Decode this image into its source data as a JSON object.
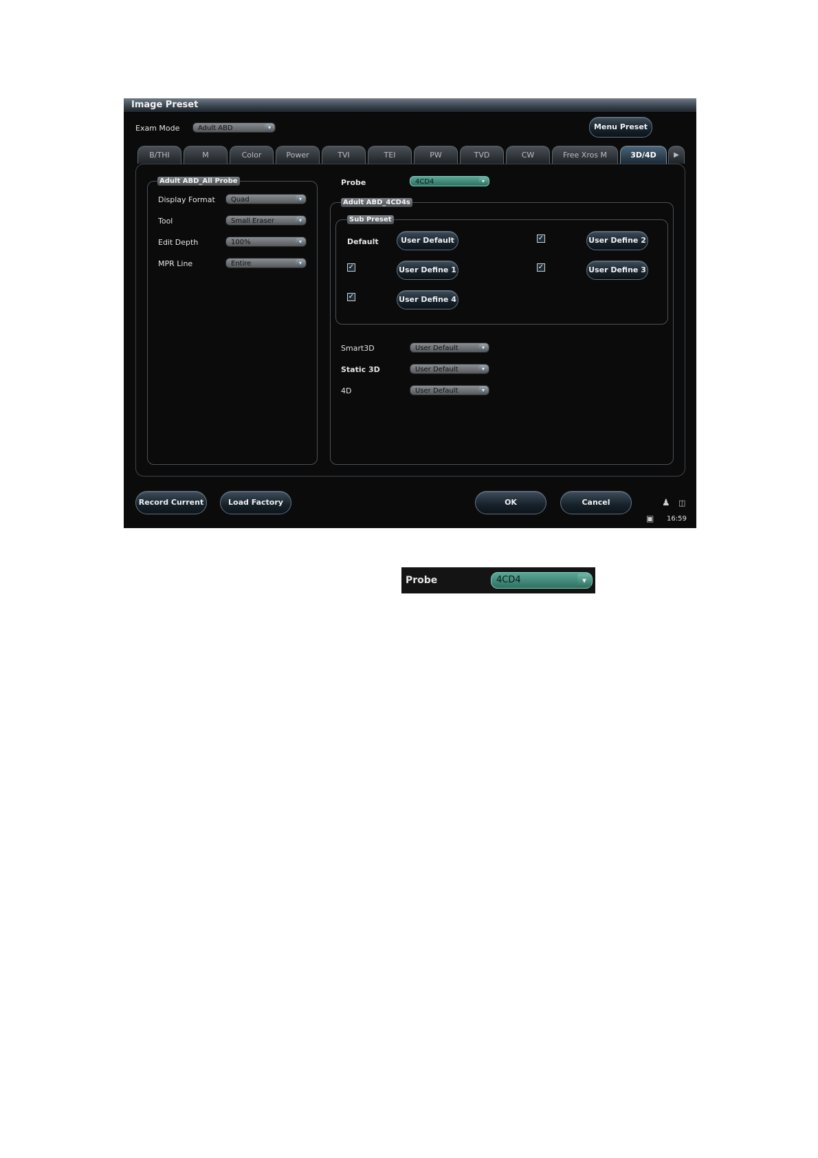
{
  "window": {
    "title": "Image Preset"
  },
  "exam_mode": {
    "label": "Exam Mode",
    "value": "Adult ABD"
  },
  "menu_preset_label": "Menu Preset",
  "tabs": [
    {
      "label": "B/THI"
    },
    {
      "label": "M"
    },
    {
      "label": "Color"
    },
    {
      "label": "Power"
    },
    {
      "label": "TVI"
    },
    {
      "label": "TEI"
    },
    {
      "label": "PW"
    },
    {
      "label": "TVD"
    },
    {
      "label": "CW"
    },
    {
      "label": "Free Xros M"
    },
    {
      "label": "3D/4D",
      "active": true
    }
  ],
  "left_panel": {
    "legend": "Adult ABD_All Probe",
    "rows": [
      {
        "label": "Display Format",
        "value": "Quad"
      },
      {
        "label": "Tool",
        "value": "Small Eraser"
      },
      {
        "label": "Edit Depth",
        "value": "100%"
      },
      {
        "label": "MPR Line",
        "value": "Entire"
      }
    ]
  },
  "probe": {
    "label": "Probe",
    "value": "4CD4"
  },
  "right_panel": {
    "legend": "Adult ABD_4CD4s",
    "sub_preset": {
      "legend": "Sub Preset",
      "default_label": "Default",
      "user_default_label": "User Default",
      "user_define_1": "User Define 1",
      "user_define_2": "User Define 2",
      "user_define_3": "User Define 3",
      "user_define_4": "User Define 4",
      "check_glyph": "✓"
    },
    "modes": [
      {
        "label": "Smart3D",
        "value": "User Default"
      },
      {
        "label": "Static 3D",
        "value": "User Default"
      },
      {
        "label": "4D",
        "value": "User Default"
      }
    ]
  },
  "footer": {
    "record_current": "Record Current",
    "load_factory": "Load Factory",
    "ok": "OK",
    "cancel": "Cancel",
    "time": "16:59"
  },
  "zoom_inset": {
    "label": "Probe",
    "value": "4CD4"
  },
  "icons": {
    "dropdown_arrow": "▾",
    "scroll_right": "▶",
    "user": "user-icon",
    "trash": "trash-icon",
    "monitor": "monitor-icon"
  },
  "colors": {
    "background": "#0b0b0b",
    "accent_green": "#5aa796",
    "title_bar": "#3b4650"
  }
}
